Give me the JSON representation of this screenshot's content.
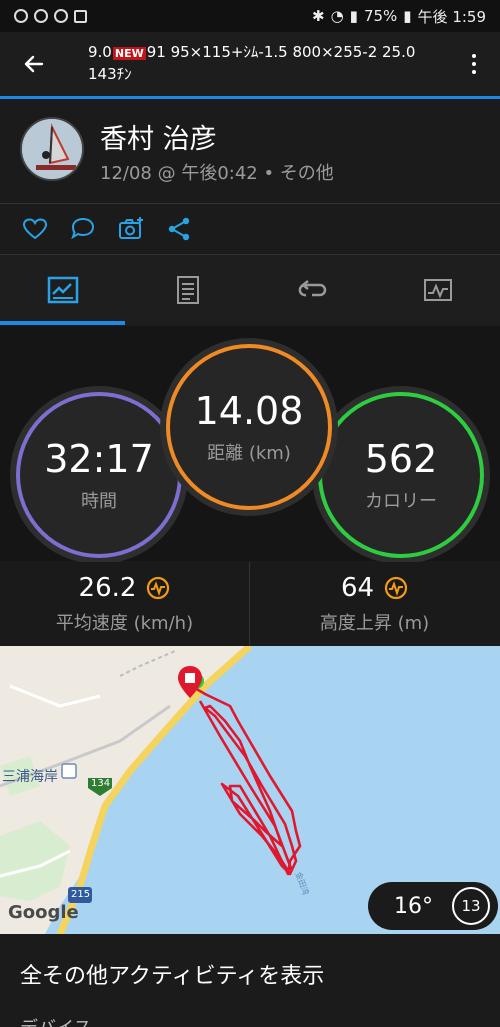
{
  "status_bar": {
    "battery": "75%",
    "time": "午後 1:59"
  },
  "top_bar": {
    "title_line1": "9.0",
    "new_badge": "NEW",
    "title_line1_rest": "91 95×115+ｼﾑ-1.5 800×255-2  25.0",
    "title_line2": "143ﾁﾝ"
  },
  "header": {
    "user_name": "香村 治彦",
    "activity_meta": "12/08 @ 午後0:42 • その他"
  },
  "stats": {
    "time": {
      "value": "32:17",
      "label": "時間"
    },
    "distance": {
      "value": "14.08",
      "label": "距離 (km)"
    },
    "calories": {
      "value": "562",
      "label": "カロリー"
    }
  },
  "metrics": {
    "avg_speed": {
      "value": "26.2",
      "label": "平均速度 (km/h)"
    },
    "elevation_gain": {
      "value": "64",
      "label": "高度上昇 (m)"
    }
  },
  "map": {
    "place_label": "三浦海岸",
    "route_134": "134",
    "route_215": "215",
    "google_label": "Google",
    "small_label": "金田湾"
  },
  "weather": {
    "temperature": "16°",
    "wind": "13"
  },
  "bottom": {
    "all_activities": "全その他アクティビティを表示",
    "device_label": "デバイス"
  },
  "colors": {
    "accent_blue": "#1e88e5",
    "time_ring": "#7b6fd0",
    "distance_ring": "#f08a24",
    "calories_ring": "#2ecc40",
    "route_red": "#e0182e",
    "ring_icon_orange": "#f39c12"
  }
}
